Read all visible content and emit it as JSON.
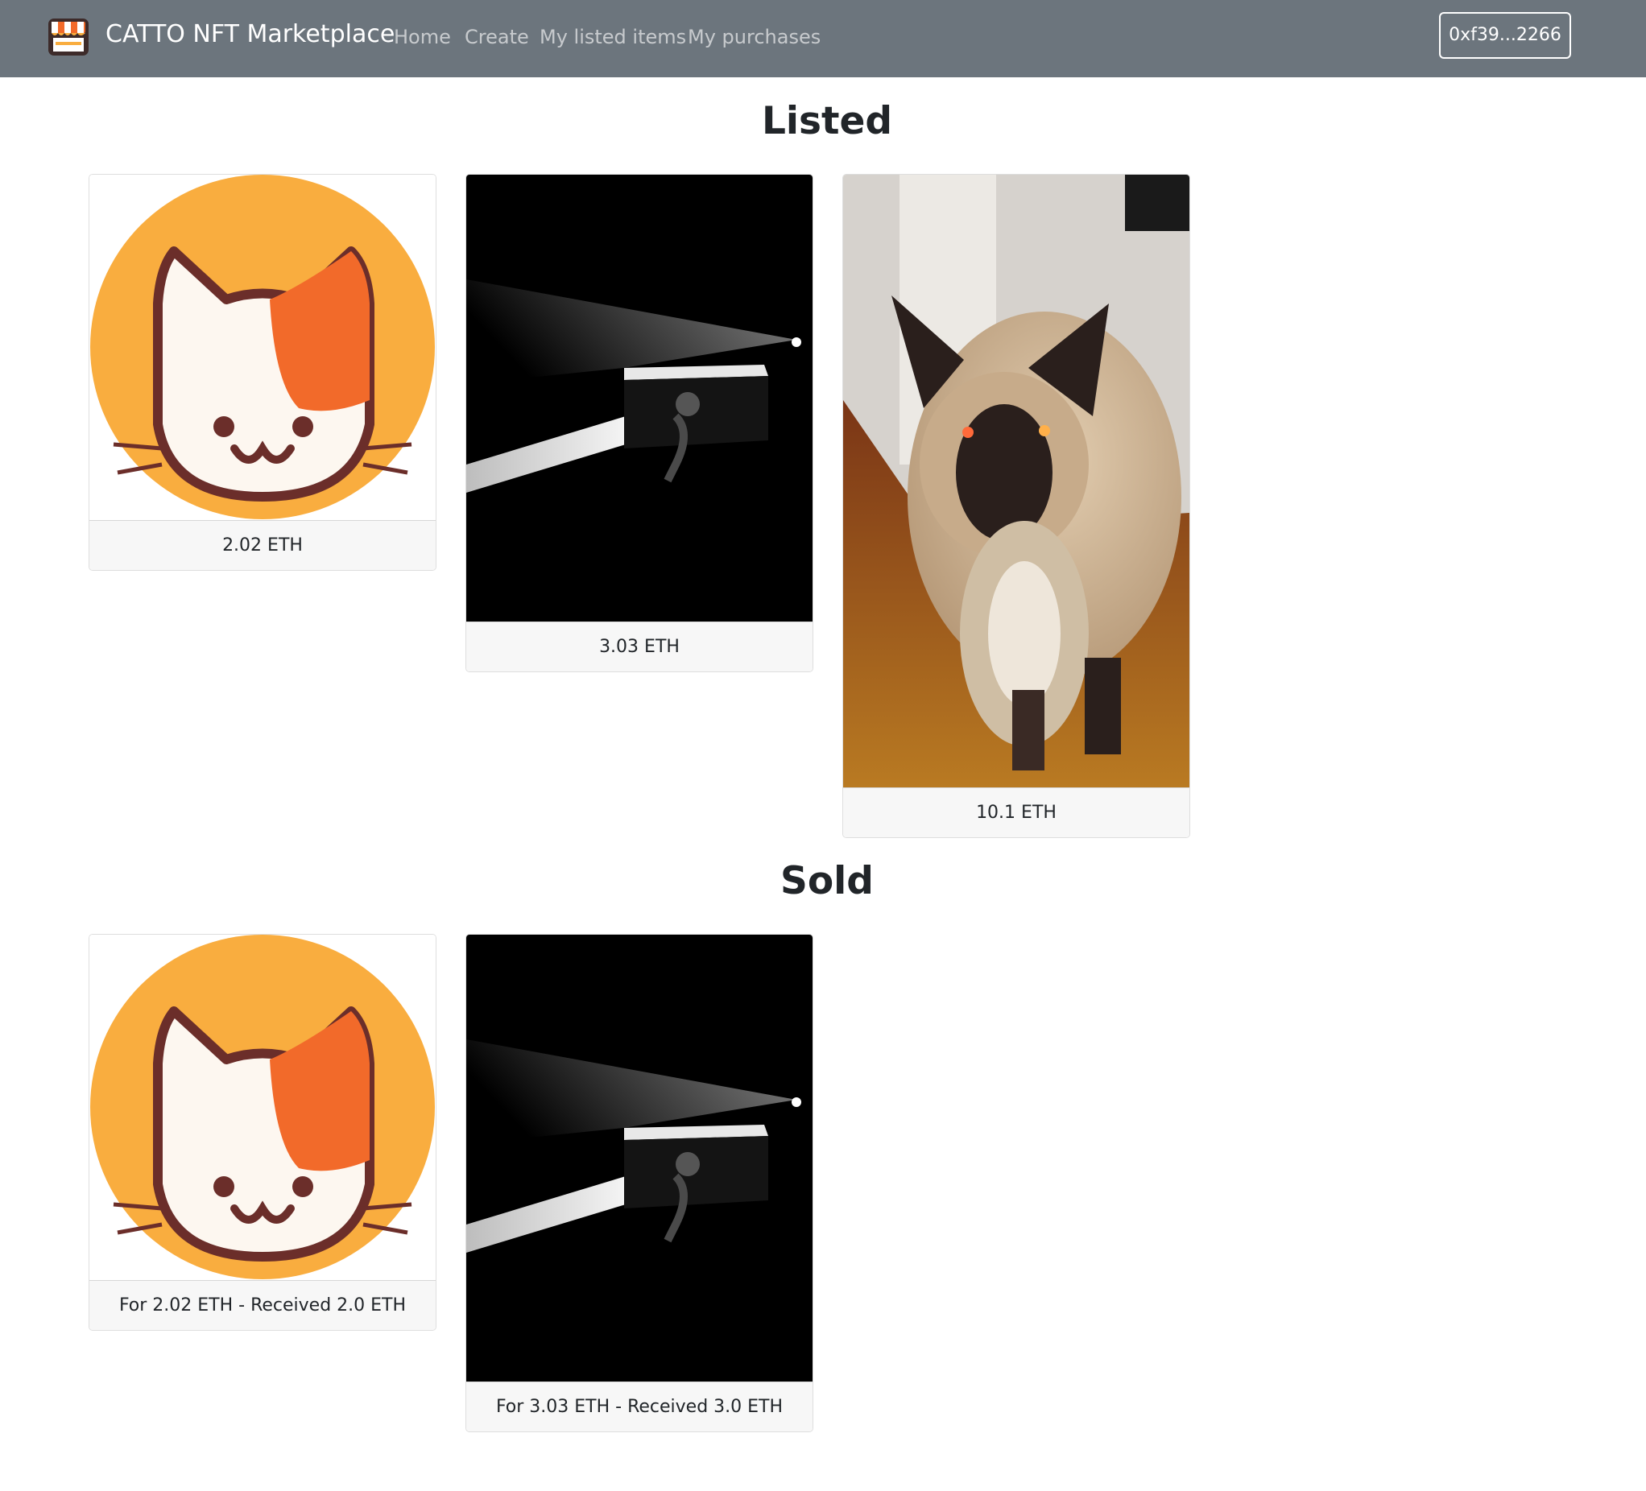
{
  "navbar": {
    "brand": "CATTO NFT Marketplace",
    "links": [
      "Home",
      "Create",
      "My listed items",
      "My purchases"
    ],
    "wallet": "0xf39...2266"
  },
  "listed": {
    "title": "Listed",
    "items": [
      {
        "price": "2.02 ETH",
        "image": "cat-logo-image"
      },
      {
        "price": "3.03 ETH",
        "image": "dark-spotlight-image"
      },
      {
        "price": "10.1 ETH",
        "image": "siamese-cat-photo"
      }
    ]
  },
  "sold": {
    "title": "Sold",
    "items": [
      {
        "caption": "For 2.02 ETH - Received 2.0 ETH",
        "image": "cat-logo-image"
      },
      {
        "caption": "For 3.03 ETH - Received 3.0 ETH",
        "image": "dark-spotlight-image"
      }
    ]
  },
  "colors": {
    "navbar": "#6c757d",
    "logo_orange": "#f9ad3f",
    "logo_patch": "#f26a2a",
    "logo_outline": "#6b2e2a"
  }
}
